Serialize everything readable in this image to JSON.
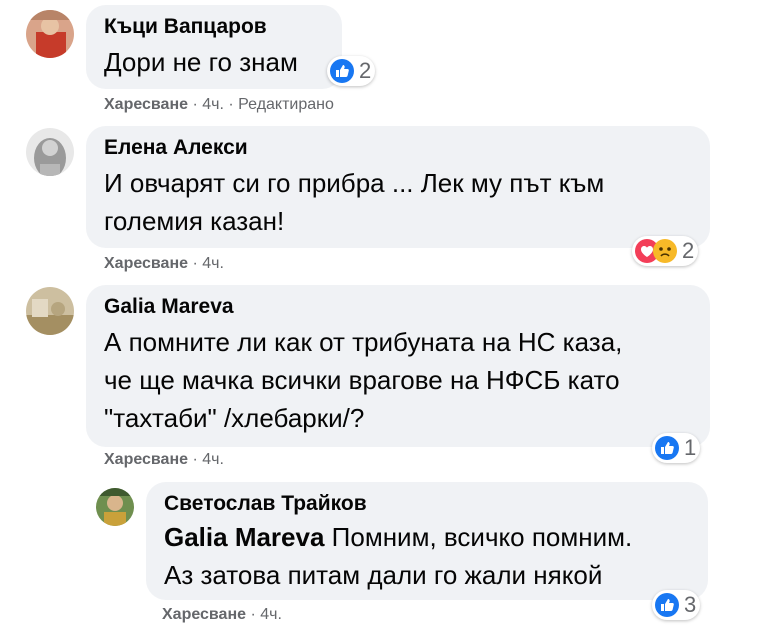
{
  "comments": [
    {
      "author": "Къци Вапцаров",
      "text": "Дори не го знам",
      "like_label": "Харесване",
      "time": "4ч.",
      "edited": "Редактирано",
      "reaction_count": "2"
    },
    {
      "author": "Елена Алекси",
      "text_line1": "И овчарят си го прибра ... Лек му път към",
      "text_line2": "големия казан!",
      "like_label": "Харесване",
      "time": "4ч.",
      "reaction_count": "2"
    },
    {
      "author": "Galia Mareva",
      "text_line1": "А помните ли как от трибуната на НС каза,",
      "text_line2": "че ще мачка всички врагове на НФСБ като",
      "text_line3": "\"тахтаби\" /хлебарки/?",
      "like_label": "Харесване",
      "time": "4ч.",
      "reaction_count": "1"
    },
    {
      "author": "Светослав Трайков",
      "mention": "Galia Mareva",
      "text_line1": "Помним, всичко помним.",
      "text_line2": "Аз затова питам дали го жали някой",
      "like_label": "Харесване",
      "time": "4ч.",
      "reaction_count": "3"
    }
  ],
  "separator": "·",
  "colors": {
    "bubble": "#f0f2f5",
    "meta_text": "#65676b",
    "like_blue": "#1877f2",
    "love_red": "#f33e58",
    "sad_yellow": "#f7b928"
  }
}
